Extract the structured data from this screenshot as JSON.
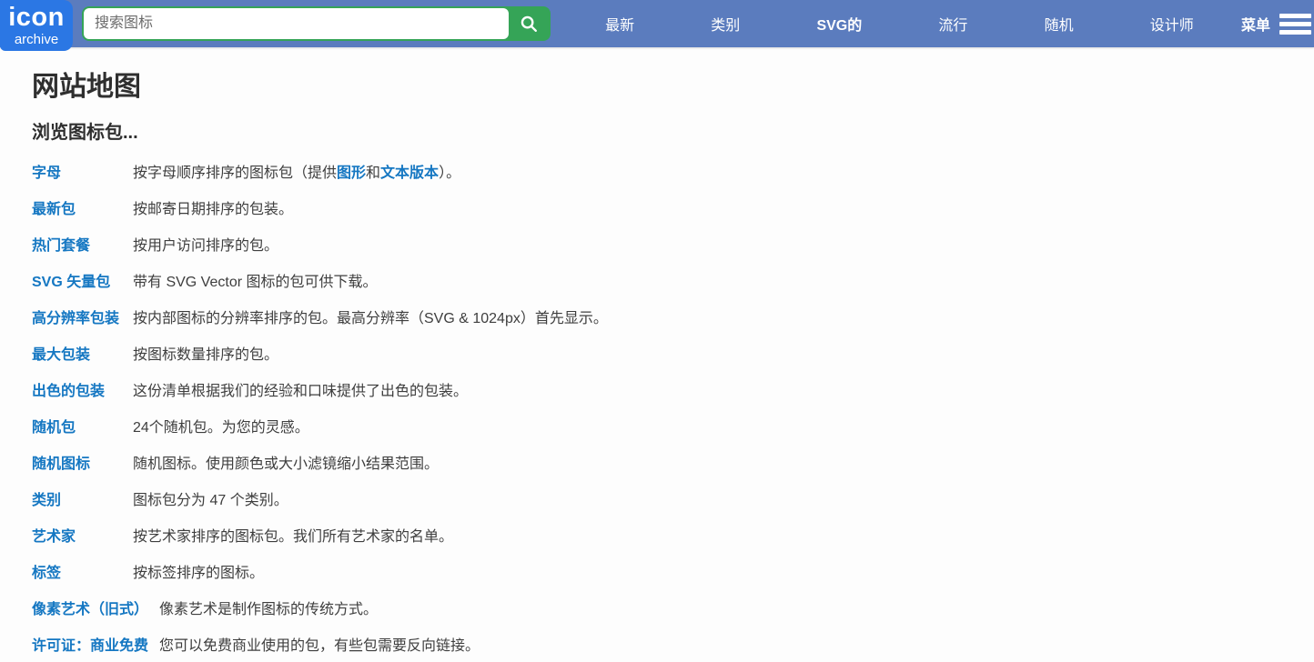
{
  "colors": {
    "header_blue": "#5b7cbe",
    "logo_blue": "#2b77e4",
    "search_green": "#35a457",
    "link_blue": "#1577c2",
    "text_dark": "#3e3e3e"
  },
  "header": {
    "logo": {
      "line1": "icon",
      "line2": "archive"
    },
    "search": {
      "placeholder": "搜索图标"
    },
    "nav": {
      "latest": "最新",
      "categories": "类别",
      "svg": "SVG的",
      "popular": "流行",
      "random": "随机",
      "designers": "设计师",
      "menu": "菜单"
    }
  },
  "page": {
    "title": "网站地图",
    "subtitle": "浏览图标包...",
    "rows": [
      {
        "link": "字母",
        "desc_prefix": "按字母顺序排序的图标包（提供",
        "inline_link_1": "图形",
        "desc_mid": "和",
        "inline_link_2": "文本版本",
        "desc_suffix": "）。"
      },
      {
        "link": "最新包",
        "desc": "按邮寄日期排序的包装。"
      },
      {
        "link": "热门套餐",
        "desc": "按用户访问排序的包。"
      },
      {
        "link": "SVG 矢量包",
        "desc": "带有 SVG Vector 图标的包可供下载。"
      },
      {
        "link": "高分辨率包装",
        "desc": "按内部图标的分辨率排序的包。最高分辨率（SVG & 1024px）首先显示。"
      },
      {
        "link": "最大包装",
        "desc": "按图标数量排序的包。"
      },
      {
        "link": "出色的包装",
        "desc": "这份清单根据我们的经验和口味提供了出色的包装。"
      },
      {
        "link": "随机包",
        "desc": "24个随机包。为您的灵感。"
      },
      {
        "link": "随机图标",
        "desc": "随机图标。使用颜色或大小滤镜缩小结果范围。"
      },
      {
        "link": "类别",
        "desc": "图标包分为 47 个类别。"
      },
      {
        "link": "艺术家",
        "desc": "按艺术家排序的图标包。我们所有艺术家的名单。"
      },
      {
        "link": "标签",
        "desc": "按标签排序的图标。"
      },
      {
        "link": "像素艺术（旧式）",
        "desc": "像素艺术是制作图标的传统方式。"
      },
      {
        "link": "许可证：商业免费",
        "desc": "您可以免费商业使用的包，有些包需要反向链接。"
      }
    ]
  }
}
